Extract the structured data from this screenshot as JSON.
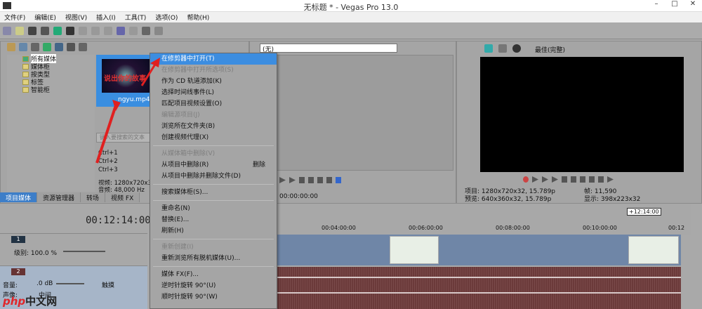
{
  "window": {
    "title": "无标题 * - Vegas Pro 13.0",
    "minimize": "–",
    "maximize": "□",
    "close": "✕"
  },
  "menubar": [
    "文件(F)",
    "编辑(E)",
    "视图(V)",
    "插入(I)",
    "工具(T)",
    "选项(O)",
    "帮助(H)"
  ],
  "project_media": {
    "tree": [
      "所有媒体",
      "媒体柜",
      "按类型",
      "标签",
      "智能柜"
    ],
    "thumbnail_text": "说出你的故事",
    "file_name": "ngyu.mp4",
    "search_placeholder": "键入要搜索的文本",
    "shortcuts": [
      "Ctrl+1",
      "Ctrl+2",
      "Ctrl+3"
    ],
    "info": [
      "视频: 1280x720x3",
      "音频: 48,000 Hz"
    ],
    "tabs": [
      "项目媒体",
      "资源管理器",
      "转场",
      "视频 FX"
    ]
  },
  "trimmer": {
    "selector": "(无)",
    "time": "00:00:00:00"
  },
  "preview": {
    "mode": "最佳(完整)",
    "project": "项目: 1280x720x32, 15.789p",
    "preview": "预览: 640x360x32, 15.789p",
    "frame_label": "帧:",
    "frame": "11,590",
    "display": "显示: 398x223x32"
  },
  "timeline": {
    "time": "00:12:14:00",
    "end_marker": "+12:14:00",
    "ruler": [
      "00:04:00:00",
      "00:06:00:00",
      "00:08:00:00",
      "00:10:00:00",
      "00:12"
    ],
    "track1": {
      "num": "1",
      "level_label": "级别: 100.0 %"
    },
    "track2": {
      "num": "2",
      "volume_label": "音量:",
      "volume": ".0 dB",
      "pan_label": "声像:",
      "pan": "中间",
      "mode": "触摸"
    }
  },
  "context_menu": [
    {
      "label": "在修剪器中打开(T)",
      "state": "highlighted"
    },
    {
      "label": "在修剪器中打开所选项(S)",
      "state": "disabled"
    },
    {
      "label": "作为 CD 轨道添加(K)",
      "state": "normal"
    },
    {
      "label": "选择时间线事件(L)",
      "state": "normal"
    },
    {
      "label": "匹配项目视频设置(O)",
      "state": "normal"
    },
    {
      "label": "编辑源项目(J)",
      "state": "disabled"
    },
    {
      "label": "浏览所在文件夹(B)",
      "state": "normal"
    },
    {
      "label": "创建视频代理(X)",
      "state": "normal"
    },
    {
      "sep": true
    },
    {
      "label": "从媒体箱中删除(V)",
      "state": "disabled"
    },
    {
      "label": "从项目中删除(R)",
      "state": "normal",
      "shortcut": "删除"
    },
    {
      "label": "从项目中删除并删除文件(D)",
      "state": "normal"
    },
    {
      "sep": true
    },
    {
      "label": "搜索媒体柜(S)...",
      "state": "normal"
    },
    {
      "sep": true
    },
    {
      "label": "重命名(N)",
      "state": "normal"
    },
    {
      "label": "替换(E)...",
      "state": "normal"
    },
    {
      "label": "刷新(H)",
      "state": "normal"
    },
    {
      "sep": true
    },
    {
      "label": "重新创建(I)",
      "state": "disabled"
    },
    {
      "label": "重新浏览所有脱机媒体(U)...",
      "state": "normal"
    },
    {
      "sep": true
    },
    {
      "label": "媒体 FX(F)...",
      "state": "normal"
    },
    {
      "label": "逆时针旋转 90°(U)",
      "state": "normal"
    },
    {
      "label": "顺时针旋转 90°(W)",
      "state": "normal"
    }
  ],
  "watermark": {
    "brand": "php",
    "text": "中文网"
  },
  "colors": {
    "highlight": "#3c8de0",
    "arrow": "#e02020"
  }
}
